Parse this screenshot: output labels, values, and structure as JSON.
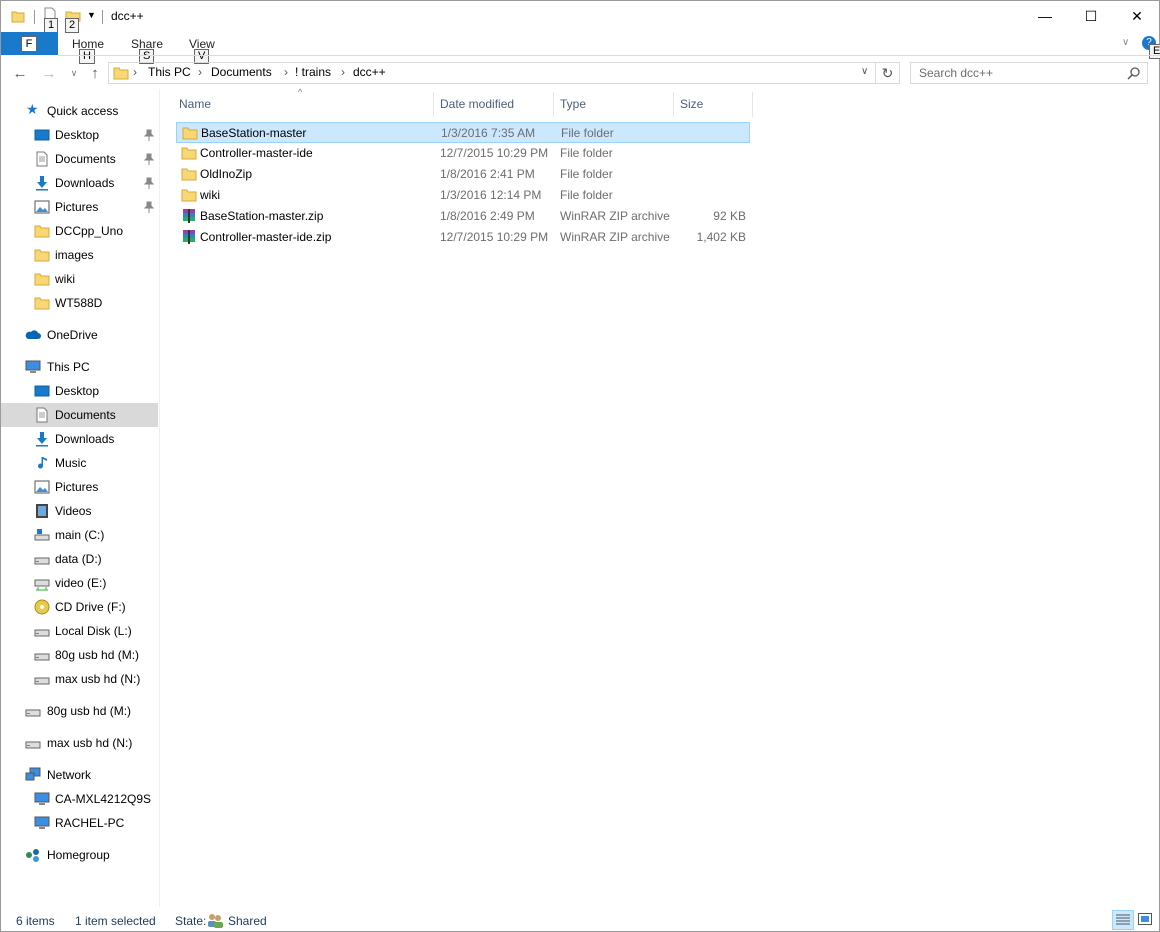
{
  "window": {
    "title": "dcc++",
    "qat_keytips": [
      "1",
      "2"
    ],
    "controls": {
      "minimize": "—",
      "maximize": "☐",
      "close": "✕"
    }
  },
  "ribbon": {
    "file_keytip": "F",
    "tabs": [
      {
        "label": "Home",
        "keytip": "H"
      },
      {
        "label": "Share",
        "keytip": "S"
      },
      {
        "label": "View",
        "keytip": "V"
      }
    ],
    "help_keytip": "E",
    "accent": "#1979ca"
  },
  "address": {
    "crumbs": [
      "This PC",
      "Documents",
      "! trains",
      "dcc++"
    ]
  },
  "search": {
    "placeholder": "Search dcc++"
  },
  "nav": {
    "quick_access": "Quick access",
    "quick_items": [
      {
        "label": "Desktop",
        "icon": "desktop-icon",
        "pinned": true
      },
      {
        "label": "Documents",
        "icon": "documents-icon",
        "pinned": true
      },
      {
        "label": "Downloads",
        "icon": "downloads-icon",
        "pinned": true
      },
      {
        "label": "Pictures",
        "icon": "pictures-icon",
        "pinned": true
      },
      {
        "label": "DCCpp_Uno",
        "icon": "folder-icon",
        "pinned": false
      },
      {
        "label": "images",
        "icon": "folder-icon",
        "pinned": false
      },
      {
        "label": "wiki",
        "icon": "folder-icon",
        "pinned": false
      },
      {
        "label": "WT588D",
        "icon": "folder-icon",
        "pinned": false
      }
    ],
    "onedrive": "OneDrive",
    "this_pc": "This PC",
    "pc_items": [
      {
        "label": "Desktop",
        "icon": "desktop-icon"
      },
      {
        "label": "Documents",
        "icon": "documents-icon",
        "selected": true
      },
      {
        "label": "Downloads",
        "icon": "downloads-icon"
      },
      {
        "label": "Music",
        "icon": "music-icon"
      },
      {
        "label": "Pictures",
        "icon": "pictures-icon"
      },
      {
        "label": "Videos",
        "icon": "videos-icon"
      },
      {
        "label": "main (C:)",
        "icon": "system-drive-icon"
      },
      {
        "label": "data (D:)",
        "icon": "drive-icon"
      },
      {
        "label": "video (E:)",
        "icon": "network-drive-icon"
      },
      {
        "label": "CD Drive (F:)",
        "icon": "cd-drive-icon"
      },
      {
        "label": "Local Disk (L:)",
        "icon": "drive-icon"
      },
      {
        "label": "80g usb hd (M:)",
        "icon": "drive-icon"
      },
      {
        "label": "max usb hd (N:)",
        "icon": "drive-icon"
      }
    ],
    "roots": [
      {
        "label": "80g usb hd (M:)",
        "icon": "drive-icon"
      },
      {
        "label": "max usb hd (N:)",
        "icon": "drive-icon"
      }
    ],
    "network": "Network",
    "network_items": [
      {
        "label": "CA-MXL4212Q9S",
        "icon": "computer-icon"
      },
      {
        "label": "RACHEL-PC",
        "icon": "computer-icon"
      }
    ],
    "homegroup": "Homegroup"
  },
  "list": {
    "columns": {
      "name": "Name",
      "date": "Date modified",
      "type": "Type",
      "size": "Size"
    },
    "rows": [
      {
        "name": "BaseStation-master",
        "date": "1/3/2016 7:35 AM",
        "type": "File folder",
        "size": "",
        "icon": "folder-icon",
        "selected": true
      },
      {
        "name": "Controller-master-ide",
        "date": "12/7/2015 10:29 PM",
        "type": "File folder",
        "size": "",
        "icon": "folder-icon"
      },
      {
        "name": "OldInoZip",
        "date": "1/8/2016 2:41 PM",
        "type": "File folder",
        "size": "",
        "icon": "folder-icon"
      },
      {
        "name": "wiki",
        "date": "1/3/2016 12:14 PM",
        "type": "File folder",
        "size": "",
        "icon": "folder-icon"
      },
      {
        "name": "BaseStation-master.zip",
        "date": "1/8/2016 2:49 PM",
        "type": "WinRAR ZIP archive",
        "size": "92 KB",
        "icon": "winrar-archive-icon"
      },
      {
        "name": "Controller-master-ide.zip",
        "date": "12/7/2015 10:29 PM",
        "type": "WinRAR ZIP archive",
        "size": "1,402 KB",
        "icon": "winrar-archive-icon"
      }
    ]
  },
  "status": {
    "items": "6 items",
    "selected": "1 item selected",
    "state_label": "State:",
    "state_value": "Shared"
  }
}
